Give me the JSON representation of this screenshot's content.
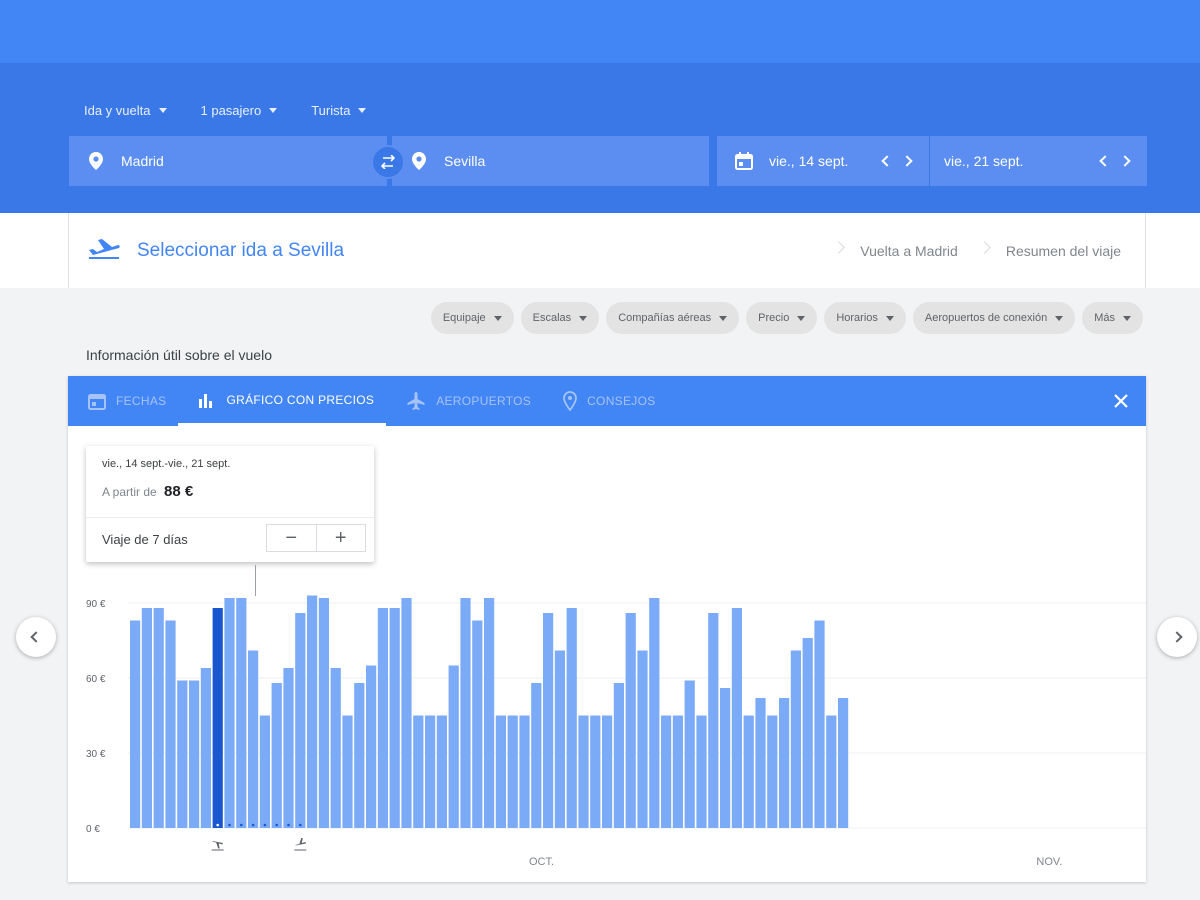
{
  "search": {
    "trip_type": "Ida y vuelta",
    "passengers": "1 pasajero",
    "cabin": "Turista",
    "origin": "Madrid",
    "destination": "Sevilla",
    "depart_date": "vie., 14 sept.",
    "return_date": "vie., 21 sept."
  },
  "steps": {
    "current": "Seleccionar ida a Sevilla",
    "next": "Vuelta a Madrid",
    "summary": "Resumen del viaje"
  },
  "filters": [
    "Equipaje",
    "Escalas",
    "Compañías aéreas",
    "Precio",
    "Horarios",
    "Aeropuertos de conexión",
    "Más"
  ],
  "section_label": "Información útil sobre el vuelo",
  "tabs": {
    "dates": "FECHAS",
    "price_graph": "GRÁFICO CON PRECIOS",
    "airports": "AEROPUERTOS",
    "tips": "CONSEJOS"
  },
  "tooltip": {
    "dates": "vie., 14 sept.-vie., 21 sept.",
    "price_prefix": "A partir de",
    "price": "88 €",
    "trip_length": "Viaje de 7 días",
    "minus": "−",
    "plus": "+"
  },
  "colors": {
    "brand": "#4285f4",
    "header_dark": "#3b78e7",
    "bar": "#7baaf7",
    "bar_selected": "#1a57cf"
  },
  "chart_data": {
    "type": "bar",
    "ylim": [
      0,
      90
    ],
    "y_ticks": [
      {
        "value": 90,
        "label": "90 €"
      },
      {
        "value": 60,
        "label": "60 €"
      },
      {
        "value": 30,
        "label": "30 €"
      },
      {
        "value": 0,
        "label": "0 €"
      }
    ],
    "month_labels": [
      {
        "index": 35,
        "label": "OCT."
      },
      {
        "index": 78,
        "label": "NOV."
      }
    ],
    "selected_index": 7,
    "depart_marker_index": 7,
    "return_marker_index": 14,
    "values": [
      83,
      88,
      88,
      83,
      59,
      59,
      64,
      88,
      92,
      92,
      71,
      45,
      58,
      64,
      86,
      93,
      92,
      64,
      45,
      58,
      65,
      88,
      88,
      92,
      45,
      45,
      45,
      65,
      92,
      83,
      92,
      45,
      45,
      45,
      58,
      86,
      71,
      88,
      45,
      45,
      45,
      58,
      86,
      71,
      92,
      45,
      45,
      59,
      45,
      86,
      56,
      88,
      45,
      52,
      45,
      52,
      71,
      76,
      83,
      45,
      52
    ]
  }
}
